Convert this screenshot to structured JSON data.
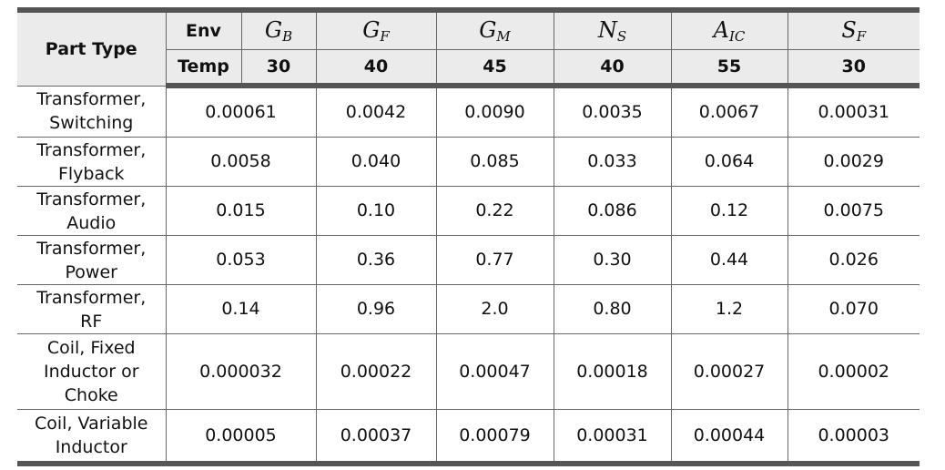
{
  "table": {
    "header": {
      "part_type": "Part Type",
      "env_label": "Env",
      "temp_label": "Temp",
      "columns": [
        {
          "base": "G",
          "sub": "B",
          "temp": "30"
        },
        {
          "base": "G",
          "sub": "F",
          "temp": "40"
        },
        {
          "base": "G",
          "sub": "M",
          "temp": "45"
        },
        {
          "base": "N",
          "sub": "S",
          "temp": "40"
        },
        {
          "base": "A",
          "sub": "IC",
          "temp": "55"
        },
        {
          "base": "S",
          "sub": "F",
          "temp": "30"
        }
      ]
    },
    "rows": [
      {
        "part": [
          "Transformer,",
          "Switching"
        ],
        "values": [
          "0.00061",
          "0.0042",
          "0.0090",
          "0.0035",
          "0.0067",
          "0.00031"
        ]
      },
      {
        "part": [
          "Transformer,",
          "Flyback"
        ],
        "values": [
          "0.0058",
          "0.040",
          "0.085",
          "0.033",
          "0.064",
          "0.0029"
        ]
      },
      {
        "part": [
          "Transformer,",
          "Audio"
        ],
        "values": [
          "0.015",
          "0.10",
          "0.22",
          "0.086",
          "0.12",
          "0.0075"
        ]
      },
      {
        "part": [
          "Transformer,",
          "Power"
        ],
        "values": [
          "0.053",
          "0.36",
          "0.77",
          "0.30",
          "0.44",
          "0.026"
        ]
      },
      {
        "part": [
          "Transformer,",
          "RF"
        ],
        "values": [
          "0.14",
          "0.96",
          "2.0",
          "0.80",
          "1.2",
          "0.070"
        ]
      },
      {
        "part": [
          "Coil, Fixed",
          "Inductor or",
          "Choke"
        ],
        "values": [
          "0.000032",
          "0.00022",
          "0.00047",
          "0.00018",
          "0.00027",
          "0.00002"
        ]
      },
      {
        "part": [
          "Coil, Variable",
          "Inductor"
        ],
        "values": [
          "0.00005",
          "0.00037",
          "0.00079",
          "0.00031",
          "0.00044",
          "0.00003"
        ]
      }
    ]
  }
}
